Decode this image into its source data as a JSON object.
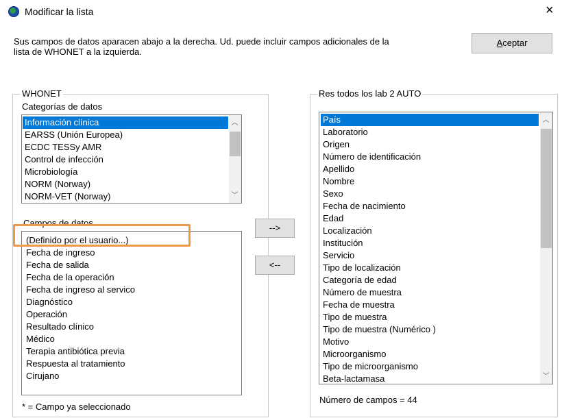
{
  "window": {
    "title": "Modificar la lista",
    "close_glyph": "×"
  },
  "instructions": {
    "line1": "Sus campos de datos aparacen abajo a la derecha.  Ud. puede incluir campos adicionales de la",
    "line2": "lista de WHONET a la izquierda."
  },
  "accept_button": {
    "accel": "A",
    "rest": "ceptar"
  },
  "left_group": {
    "legend": "WHONET",
    "categories_label": "Categorías de datos",
    "categories": [
      "Información clínica",
      "EARSS (Unión Europea)",
      "ECDC TESSy AMR",
      "Control de infección",
      "Microbiología",
      "NORM (Norway)",
      "NORM-VET (Norway)"
    ],
    "fields_label": "Campos de datos",
    "fields": [
      "(Definido por el usuario...)",
      "Fecha de ingreso",
      "Fecha de salida",
      "Fecha de la operación",
      "Fecha de ingreso al servico",
      "Diagnóstico",
      "Operación",
      "Resultado clínico",
      "Médico",
      "Terapia antibiótica previa",
      "Respuesta al tratamiento",
      "Cirujano"
    ],
    "footnote": "* = Campo ya seleccionado"
  },
  "move_buttons": {
    "add": "-->",
    "remove": "<--"
  },
  "right_group": {
    "legend": "Res todos los lab 2 AUTO",
    "fields": [
      "País",
      "Laboratorio",
      "Origen",
      "Número de identificación",
      "Apellido",
      "Nombre",
      "Sexo",
      "Fecha de nacimiento",
      "Edad",
      "Localización",
      "Institución",
      "Servicio",
      "Tipo de localización",
      "Categoría de edad",
      "Número de muestra",
      "Fecha de muestra",
      "Tipo de muestra",
      "Tipo de muestra (Numérico )",
      "Motivo",
      "Microorganismo",
      "Tipo de microorganismo",
      "Beta-lactamasa"
    ],
    "count_label": "Número de campos = 44"
  },
  "colors": {
    "selection": "#0078d7",
    "highlight": "#f0984a"
  },
  "icons": {
    "app": "globe-icon",
    "up": "chevron-up-icon",
    "down": "chevron-down-icon"
  }
}
